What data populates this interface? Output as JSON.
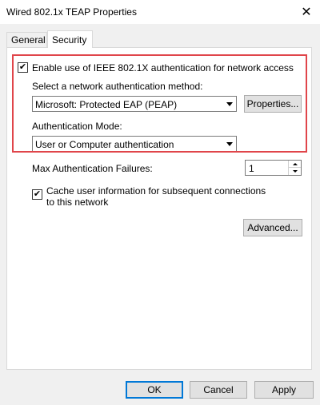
{
  "window": {
    "title": "Wired 802.1x TEAP Properties",
    "close_symbol": "✕"
  },
  "tabs": [
    {
      "label": "General",
      "selected": false
    },
    {
      "label": "Security",
      "selected": true
    }
  ],
  "security": {
    "enable_8021x": {
      "label": "Enable use of IEEE 802.1X authentication for network access",
      "checked": true
    },
    "method_label": "Select a network authentication method:",
    "method_value": "Microsoft: Protected EAP (PEAP)",
    "properties_button": "Properties...",
    "auth_mode_label": "Authentication Mode:",
    "auth_mode_value": "User or Computer authentication",
    "max_failures_label": "Max Authentication Failures:",
    "max_failures_value": "1",
    "cache_info": {
      "line1": "Cache user information for subsequent connections",
      "line2": "to this network",
      "checked": true
    },
    "advanced_button": "Advanced..."
  },
  "footer": {
    "ok": "OK",
    "cancel": "Cancel",
    "apply": "Apply"
  },
  "colors": {
    "highlight": "#e0454a",
    "default_button_border": "#0078d7"
  },
  "icons": {
    "check": "✔"
  }
}
